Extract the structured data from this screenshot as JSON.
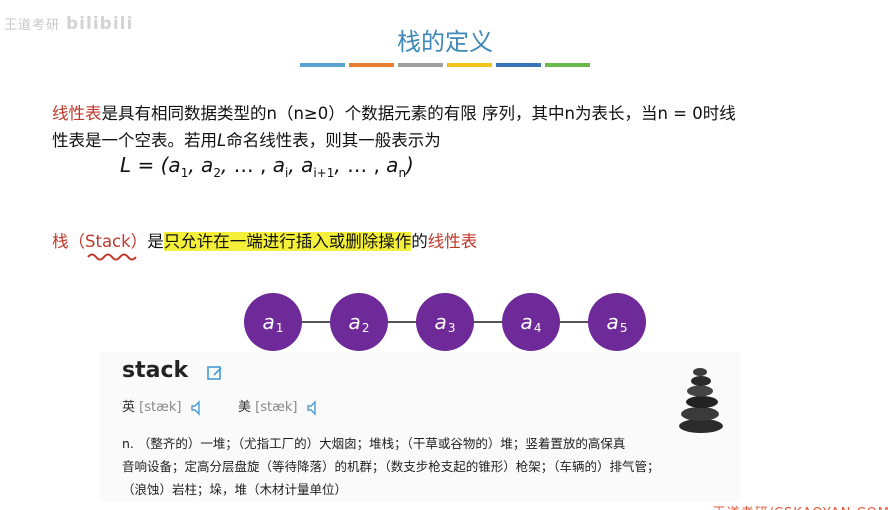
{
  "watermark": {
    "text": "王道考研",
    "logo": "bilibili"
  },
  "slide": {
    "title": "栈的定义",
    "color_bar": [
      "#5aa3d0",
      "#e57c2f",
      "#a0a0a0",
      "#f2c318",
      "#3a73b8",
      "#6ab94a"
    ]
  },
  "paragraph": {
    "term": "线性表",
    "rest_line1": "是具有相同数据类型的n（n≥0）个数据元素的有限 序列，其中n为表长，当n = 0时线",
    "line2_a": "性表是一个空表。若用",
    "line2_L": "L",
    "line2_b": "命名线性表，则其一般表示为"
  },
  "formula": {
    "lhs": "L = (",
    "a": "a",
    "s1": "1",
    "s2": "2",
    "si": "i",
    "si1": "i+1",
    "sn": "n",
    "sep": ", ",
    "dots": "… ,",
    "close": ")"
  },
  "stack_def": {
    "term": "栈（Stack）",
    "is": "是",
    "highlight": "只允许在一端进行插入或删除操作",
    "of": "的",
    "linear": "线性表"
  },
  "nodes": [
    {
      "letter": "a",
      "sub": "1"
    },
    {
      "letter": "a",
      "sub": "2"
    },
    {
      "letter": "a",
      "sub": "3"
    },
    {
      "letter": "a",
      "sub": "4"
    },
    {
      "letter": "a",
      "sub": "5"
    }
  ],
  "dictionary": {
    "word": "stack",
    "uk_label": "英",
    "uk_phonetic": "[stæk]",
    "us_label": "美",
    "us_phonetic": "[stæk]",
    "definition_l1": "n. （整齐的）一堆；（尤指工厂的）大烟囱；堆栈；（干草或谷物的）堆；竖着置放的高保真",
    "definition_l2": "音响设备；定高分层盘旋（等待降落）的机群；（数支步枪支起的锥形）枪架；（车辆的）排气管；",
    "definition_l3": "（浪蚀）岩柱；垛，堆（木材计量单位）"
  },
  "footer": {
    "text": "王道考研/CSKAOYAN.COM"
  },
  "colors": {
    "title": "#3f88b8",
    "term_red": "#c0392b",
    "node_purple": "#6f2a9a",
    "highlight": "#f4f03a"
  },
  "icons": [
    "edit-icon",
    "speaker-icon",
    "stone-stack-image"
  ]
}
